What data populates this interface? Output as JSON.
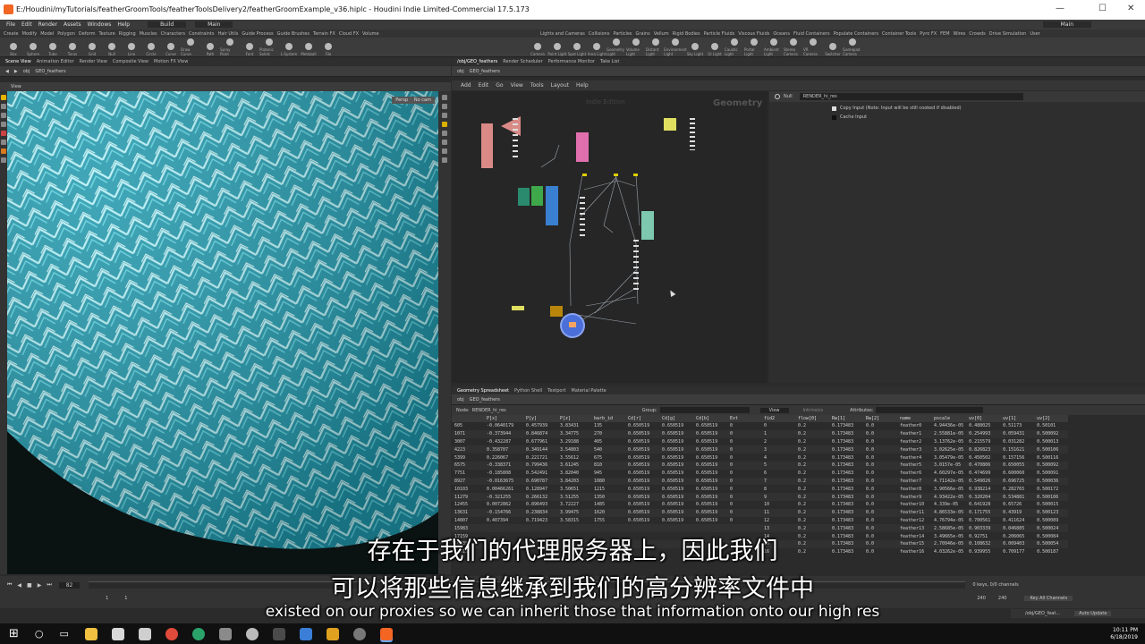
{
  "window": {
    "title": "E:/Houdini/myTutorials/featherGroomTools/featherToolsDelivery2/featherGroomExample_v36.hiplc - Houdini Indie Limited-Commercial 17.5.173",
    "minimize": "—",
    "maximize": "☐",
    "close": "✕"
  },
  "menu": [
    "File",
    "Edit",
    "Render",
    "Assets",
    "Windows",
    "Help"
  ],
  "menu_build": "Build",
  "menu_main": "Main",
  "menu_user": "Main",
  "shelf_tabs_left": [
    "Create",
    "Modify",
    "Model",
    "Polygon",
    "Deform",
    "Texture",
    "Rigging",
    "Muscles",
    "Characters",
    "Constraints",
    "Hair Utils",
    "Guide Process",
    "Guide Brushes",
    "Terrain FX",
    "Cloud FX",
    "Volume"
  ],
  "shelf_tabs_right": [
    "Lights and Cameras",
    "Collisions",
    "Particles",
    "Grains",
    "Vellum",
    "Rigid Bodies",
    "Particle Fluids",
    "Viscous Fluids",
    "Oceans",
    "Fluid Containers",
    "Populate Containers",
    "Container Tools",
    "Pyro FX",
    "FEM",
    "Wires",
    "Crowds",
    "Drive Simulation",
    "User"
  ],
  "shelf_tools_left": [
    "Box",
    "Sphere",
    "Tube",
    "Torus",
    "Grid",
    "Null",
    "Line",
    "Circle",
    "Curve",
    "Draw Curve",
    "Path",
    "Spray Paint",
    "Font",
    "Platonic Solids",
    "L-System",
    "Metaball",
    "File"
  ],
  "shelf_tools_right": [
    "Camera",
    "Point Light",
    "Spot Light",
    "Area Light",
    "Geometry Light",
    "Volume Light",
    "Distant Light",
    "Environment Light",
    "Sky Light",
    "GI Light",
    "Caustic Light",
    "Portal Light",
    "Ambient Light",
    "Stereo Camera",
    "VR Camera",
    "Switcher",
    "Gamepad Camera"
  ],
  "left_tabs": [
    "Scene View",
    "Animation Editor",
    "Render View",
    "Composite View",
    "Motion FX View"
  ],
  "left_path": [
    "obj",
    "GEO_feathers"
  ],
  "viewport_label": "View",
  "viewport_badges": [
    "Persp",
    "No cam"
  ],
  "net_tabs": [
    "/obj/GEO_feathers",
    "Render Scheduler",
    "Performance Monitor",
    "Take List"
  ],
  "net_path": [
    "obj",
    "GEO_feathers"
  ],
  "net_menu": [
    "Add",
    "Edit",
    "Go",
    "View",
    "Tools",
    "Layout",
    "Help"
  ],
  "net_watermark_1": "Indie Edition",
  "net_watermark_2": "Geometry",
  "param": {
    "node_type": "Null",
    "node_name": "RENDER_hi_res",
    "options": [
      "Copy Input (Note: Input will be still cooked if disabled)",
      "Cache Input"
    ]
  },
  "sheet_tabs": [
    "Geometry Spreadsheet",
    "Python Shell",
    "Textport",
    "Material Palette"
  ],
  "sheet_path": [
    "obj",
    "GEO_feathers"
  ],
  "sheet_toolbar": {
    "node_label": "Node:",
    "node_value": "RENDER_hi_res",
    "group_label": "Group:",
    "view_label": "View",
    "intrinsics_label": "Intrinsics",
    "attributes_label": "Attributes:"
  },
  "sheet_columns": [
    "",
    "P[x]",
    "P[y]",
    "P[z]",
    "barb_id",
    "Cd[r]",
    "Cd[g]",
    "Cd[b]",
    "Ext",
    "fid2",
    "flow[0]",
    "Rw[1]",
    "Rw[2]",
    "name",
    "pscale",
    "uv[0]",
    "uv[1]",
    "uv[2]"
  ],
  "sheet_rows": [
    [
      "605",
      "-0.0640179",
      "0.457939",
      "3.83431",
      "135",
      "0.650519",
      "0.650519",
      "0.650519",
      "0",
      "0",
      "0.2",
      "0.173483",
      "0.0",
      "feather0",
      "4.94436e-05",
      "0.488025",
      "0.51173",
      "0.50101"
    ],
    [
      "1071",
      "-0.373944",
      "0.846874",
      "3.34775",
      "270",
      "0.650519",
      "0.650519",
      "0.650519",
      "0",
      "1",
      "0.2",
      "0.173483",
      "0.0",
      "feather1",
      "2.55881e-05",
      "0.254993",
      "0.059431",
      "0.500092"
    ],
    [
      "3007",
      "-0.432287",
      "0.677961",
      "3.29188",
      "405",
      "0.650519",
      "0.650519",
      "0.650519",
      "0",
      "2",
      "0.2",
      "0.173483",
      "0.0",
      "feather2",
      "3.13762e-05",
      "0.215579",
      "0.031282",
      "0.500013"
    ],
    [
      "4223",
      "0.358707",
      "0.349144",
      "3.54803",
      "540",
      "0.650519",
      "0.650519",
      "0.650519",
      "0",
      "3",
      "0.2",
      "0.173483",
      "0.0",
      "feather3",
      "3.02625e-05",
      "0.826823",
      "0.151621",
      "0.500106"
    ],
    [
      "5399",
      "0.226067",
      "0.221721",
      "3.55612",
      "675",
      "0.650519",
      "0.650519",
      "0.650519",
      "0",
      "4",
      "0.2",
      "0.173483",
      "0.0",
      "feather4",
      "3.05479e-05",
      "0.450502",
      "0.157156",
      "0.500116"
    ],
    [
      "6575",
      "-0.338371",
      "0.799436",
      "3.61245",
      "810",
      "0.650519",
      "0.650519",
      "0.650519",
      "0",
      "5",
      "0.2",
      "0.173483",
      "0.0",
      "feather5",
      "3.0157e-05",
      "0.470806",
      "0.650055",
      "0.500092"
    ],
    [
      "7751",
      "-0.185808",
      "0.542491",
      "3.82040",
      "945",
      "0.650519",
      "0.650519",
      "0.650519",
      "0",
      "6",
      "0.2",
      "0.173483",
      "0.0",
      "feather6",
      "4.60297e-05",
      "0.474699",
      "0.600060",
      "0.500091"
    ],
    [
      "8927",
      "-0.0163675",
      "0.690787",
      "3.84203",
      "1080",
      "0.650519",
      "0.650519",
      "0.650519",
      "0",
      "7",
      "0.2",
      "0.173483",
      "0.0",
      "feather7",
      "4.71142e-05",
      "0.549026",
      "0.696725",
      "0.500036"
    ],
    [
      "10103",
      "0.00466261",
      "0.128947",
      "3.50651",
      "1215",
      "0.650519",
      "0.650519",
      "0.650519",
      "0",
      "8",
      "0.2",
      "0.173483",
      "0.0",
      "feather8",
      "3.90566e-05",
      "0.938214",
      "0.282765",
      "0.500172"
    ],
    [
      "11279",
      "-0.321255",
      "0.266132",
      "3.51255",
      "1350",
      "0.650519",
      "0.650519",
      "0.650519",
      "0",
      "9",
      "0.2",
      "0.173483",
      "0.0",
      "feather9",
      "4.93422e-05",
      "0.320204",
      "0.534881",
      "0.500106"
    ],
    [
      "12455",
      "0.0072862",
      "0.896493",
      "3.72227",
      "1485",
      "0.650519",
      "0.650519",
      "0.650519",
      "0",
      "10",
      "0.2",
      "0.173483",
      "0.0",
      "feather10",
      "4.339e-05",
      "0.641928",
      "0.65726",
      "0.500015"
    ],
    [
      "13631",
      "-0.154766",
      "0.238834",
      "3.99475",
      "1620",
      "0.650519",
      "0.650519",
      "0.650519",
      "0",
      "11",
      "0.2",
      "0.173483",
      "0.0",
      "feather11",
      "4.86533e-05",
      "0.171755",
      "0.43919",
      "0.500123"
    ],
    [
      "14807",
      "0.407394",
      "0.719423",
      "3.58315",
      "1755",
      "0.650519",
      "0.650519",
      "0.650519",
      "0",
      "12",
      "0.2",
      "0.173483",
      "0.0",
      "feather12",
      "4.76794e-05",
      "0.700561",
      "0.411624",
      "0.500089"
    ],
    [
      "15983",
      "",
      "",
      "",
      "",
      "",
      "",
      "",
      "",
      "13",
      "0.2",
      "0.173483",
      "0.0",
      "feather13",
      "2.58685e-05",
      "0.903339",
      "0.046885",
      "0.500024"
    ],
    [
      "17159",
      "",
      "",
      "",
      "",
      "",
      "",
      "",
      "",
      "14",
      "0.2",
      "0.173483",
      "0.0",
      "feather14",
      "3.49665e-05",
      "0.92751",
      "0.206065",
      "0.500084"
    ],
    [
      "18335",
      "",
      "",
      "",
      "",
      "",
      "",
      "",
      "",
      "15",
      "0.2",
      "0.173483",
      "0.0",
      "feather15",
      "2.70946e-05",
      "0.108632",
      "0.009403",
      "0.500054"
    ],
    [
      "19511",
      "",
      "",
      "",
      "",
      "",
      "",
      "",
      "",
      "16",
      "0.2",
      "0.173483",
      "0.0",
      "feather16",
      "4.03262e-05",
      "0.939955",
      "0.709177",
      "0.500187"
    ]
  ],
  "timeline": {
    "frame": "82",
    "start": "1",
    "start2": "1",
    "end": "240",
    "end2": "240",
    "keys_info": "0 keys, 0/0 channels",
    "key_all": "Key All Channels",
    "auto_update": "Auto Update",
    "obj_path": "/obj/GEO_feat..."
  },
  "subtitles": {
    "zh_line1": "存在于我们的代理服务器上，因此我们",
    "zh_line2": "可以将那些信息继承到我们的高分辨率文件中",
    "en": "existed on our proxies so we can inherit those that information onto our high res"
  },
  "taskbar": {
    "time": "10:11 PM",
    "date": "6/18/2019"
  },
  "colors": {
    "feather_cyan": "#2fb7c9",
    "houdini_orange": "#f26522",
    "panel_bg": "#3a3a3a"
  }
}
